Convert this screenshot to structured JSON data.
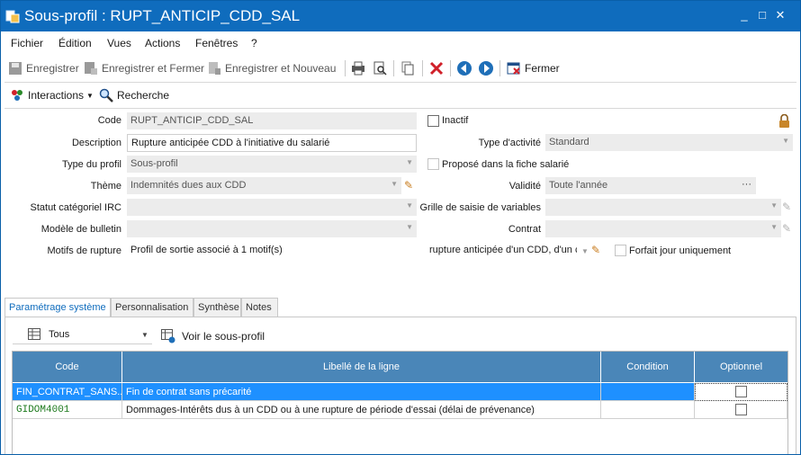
{
  "window": {
    "title": "Sous-profil : RUPT_ANTICIP_CDD_SAL",
    "minimize": "_",
    "maximize": "□",
    "close": "✕"
  },
  "menu": [
    "Fichier",
    "Édition",
    "Vues",
    "Actions",
    "Fenêtres",
    "?"
  ],
  "toolbar": {
    "save": "Enregistrer",
    "save_close": "Enregistrer et Fermer",
    "save_new": "Enregistrer et Nouveau",
    "close": "Fermer"
  },
  "toolbar2": {
    "interactions": "Interactions",
    "search": "Recherche"
  },
  "form": {
    "code_label": "Code",
    "code_value": "RUPT_ANTICIP_CDD_SAL",
    "inactive_label": "Inactif",
    "description_label": "Description",
    "description_value": "Rupture anticipée CDD à l'initiative du salarié",
    "activity_type_label": "Type d'activité",
    "activity_type_value": "Standard",
    "profile_type_label": "Type du profil",
    "profile_type_value": "Sous-profil",
    "proposed_label": "Proposé dans la fiche salarié",
    "theme_label": "Thème",
    "theme_value": "Indemnités dues aux CDD",
    "validity_label": "Validité",
    "validity_value": "Toute l'année",
    "validity_btn": "···",
    "irc_label": "Statut catégoriel IRC",
    "grid_label": "Grille de saisie de variables",
    "bulletin_label": "Modèle de bulletin",
    "contract_label": "Contrat",
    "motifs_label": "Motifs de rupture",
    "motifs_value": "Profil de sortie associé à 1 motif(s)",
    "motif_select": "rupture anticipée d'un CDD, d'un c",
    "forfait_label": "Forfait jour uniquement"
  },
  "tabs": [
    "Paramétrage système",
    "Personnalisation",
    "Synthèse",
    "Notes"
  ],
  "filter": {
    "value": "Tous",
    "view_btn": "Voir le sous-profil"
  },
  "grid": {
    "headers": [
      "Code",
      "Libellé de la ligne",
      "Condition",
      "Optionnel"
    ],
    "rows": [
      {
        "code": "FIN_CONTRAT_SANS...",
        "label": "Fin de contrat sans précarité",
        "condition": ""
      },
      {
        "code": "GIDOM4001",
        "label": "Dommages-Intérêts dus à un CDD ou à une rupture de période d'essai (délai de prévenance)",
        "condition": ""
      }
    ]
  },
  "colors": {
    "titlebar": "#0f6cbd",
    "grid_header": "#4a86b8",
    "selected_row": "#1e90ff",
    "code_green": "#1d7a1d"
  }
}
